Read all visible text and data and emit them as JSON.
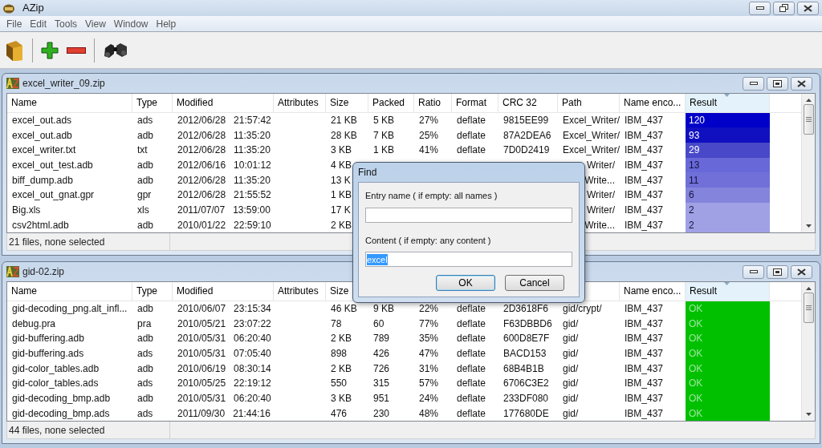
{
  "window": {
    "title": "AZip"
  },
  "menu": [
    "File",
    "Edit",
    "Tools",
    "View",
    "Window",
    "Help"
  ],
  "archives": [
    {
      "title": "excel_writer_09.zip",
      "columns": [
        "Name",
        "Type",
        "Modified",
        "Attributes",
        "Size",
        "Packed",
        "Ratio",
        "Format",
        "CRC 32",
        "Path",
        "Name enco...",
        "Result"
      ],
      "rows": [
        {
          "cells": [
            "excel_out.ads",
            "ads",
            "2012/06/28   21:57:42",
            "",
            "21 KB",
            "5 KB",
            "27%",
            "deflate",
            "9815EE99",
            "Excel_Writer/",
            "IBM_437"
          ],
          "result": "120",
          "color": "#0000c8"
        },
        {
          "cells": [
            "excel_out.adb",
            "adb",
            "2012/06/28   11:35:20",
            "",
            "28 KB",
            "7 KB",
            "25%",
            "deflate",
            "87A2DEA6",
            "Excel_Writer/",
            "IBM_437"
          ],
          "result": "93",
          "color": "#1010c0"
        },
        {
          "cells": [
            "excel_writer.txt",
            "txt",
            "2012/06/28   11:35:20",
            "",
            "3 KB",
            "1 KB",
            "41%",
            "deflate",
            "7D0D2419",
            "Excel_Writer/",
            "IBM_437"
          ],
          "result": "29",
          "color": "#4848c8"
        },
        {
          "cells": [
            "excel_out_test.adb",
            "adb",
            "2012/06/16   10:01:12",
            "",
            "4 KB",
            null,
            null,
            null,
            null,
            "Writer/",
            "IBM_437"
          ],
          "result": "13",
          "color": "#6868d8"
        },
        {
          "cells": [
            "biff_dump.adb",
            "adb",
            "2012/06/28   11:35:20",
            "",
            "13 K",
            null,
            null,
            null,
            null,
            "Write...",
            "IBM_437"
          ],
          "result": "11",
          "color": "#7070d8"
        },
        {
          "cells": [
            "excel_out_gnat.gpr",
            "gpr",
            "2012/06/28   21:55:52",
            "",
            "1 KB",
            null,
            null,
            null,
            null,
            "Writer/",
            "IBM_437"
          ],
          "result": "6",
          "color": "#8484dc"
        },
        {
          "cells": [
            "Big.xls",
            "xls",
            "2011/07/07   13:59:00",
            "",
            "17 K",
            null,
            null,
            null,
            null,
            "Writer/",
            "IBM_437"
          ],
          "result": "2",
          "color": "#a0a0e4"
        },
        {
          "cells": [
            "csv2html.adb",
            "adb",
            "2010/01/22   22:59:10",
            "",
            "2 KB",
            null,
            null,
            null,
            null,
            "Write...",
            "IBM_437"
          ],
          "result": "2",
          "color": "#a0a0e4"
        }
      ],
      "status": "21 files, none selected"
    },
    {
      "title": "gid-02.zip",
      "columns": [
        "Name",
        "Type",
        "Modified",
        "Attributes",
        "Size",
        null,
        null,
        null,
        null,
        null,
        "Name enco...",
        "Result"
      ],
      "rows": [
        {
          "cells": [
            "gid-decoding_png.alt_infl...",
            "adb",
            "2010/06/07   23:15:34",
            "",
            "46 KB",
            "9 KB",
            "22%",
            "deflate",
            "2D3618F6",
            "gid/crypt/",
            "IBM_437"
          ],
          "result": "OK",
          "color": "#00c000"
        },
        {
          "cells": [
            "debug.pra",
            "pra",
            "2010/05/21   23:07:22",
            "",
            "78",
            "60",
            "77%",
            "deflate",
            "F63DBBD6",
            "gid/",
            "IBM_437"
          ],
          "result": "OK",
          "color": "#00c000"
        },
        {
          "cells": [
            "gid-buffering.adb",
            "adb",
            "2010/05/31   06:20:40",
            "",
            "2 KB",
            "789",
            "35%",
            "deflate",
            "600D8E7F",
            "gid/",
            "IBM_437"
          ],
          "result": "OK",
          "color": "#00c000"
        },
        {
          "cells": [
            "gid-buffering.ads",
            "ads",
            "2010/05/31   07:05:40",
            "",
            "898",
            "426",
            "47%",
            "deflate",
            "BACD153",
            "gid/",
            "IBM_437"
          ],
          "result": "OK",
          "color": "#00c000"
        },
        {
          "cells": [
            "gid-color_tables.adb",
            "adb",
            "2010/06/19   08:30:14",
            "",
            "2 KB",
            "726",
            "31%",
            "deflate",
            "68B4B1B",
            "gid/",
            "IBM_437"
          ],
          "result": "OK",
          "color": "#00c000"
        },
        {
          "cells": [
            "gid-color_tables.ads",
            "ads",
            "2010/05/25   22:19:12",
            "",
            "550",
            "315",
            "57%",
            "deflate",
            "6706C3E2",
            "gid/",
            "IBM_437"
          ],
          "result": "OK",
          "color": "#00c000"
        },
        {
          "cells": [
            "gid-decoding_bmp.adb",
            "adb",
            "2010/05/31   06:20:40",
            "",
            "3 KB",
            "951",
            "24%",
            "deflate",
            "233DF080",
            "gid/",
            "IBM_437"
          ],
          "result": "OK",
          "color": "#00c000"
        },
        {
          "cells": [
            "gid-decoding_bmp.ads",
            "ads",
            "2011/09/30   21:44:16",
            "",
            "476",
            "230",
            "48%",
            "deflate",
            "177680DE",
            "gid/",
            "IBM_437"
          ],
          "result": "OK",
          "color": "#00c000"
        }
      ],
      "status": "44 files, none selected"
    }
  ],
  "dialog": {
    "title": "Find",
    "fields": [
      {
        "label": "Entry name ( if empty: all names )"
      },
      {
        "label": "Content ( if empty: any content )",
        "value": "excel"
      }
    ],
    "buttons": [
      "OK",
      "Cancel"
    ]
  }
}
